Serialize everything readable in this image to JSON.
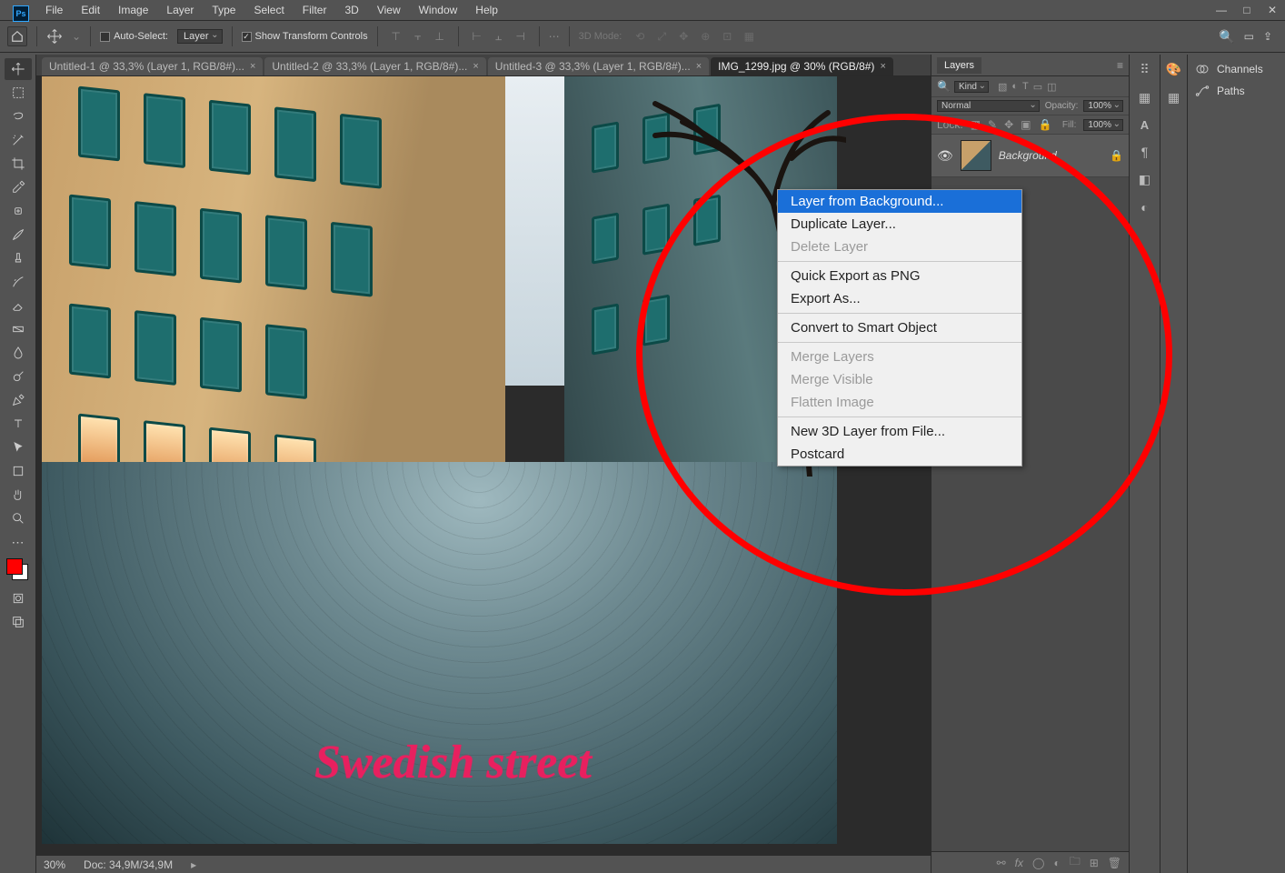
{
  "app": {
    "logo_text": "Ps"
  },
  "menu": [
    "File",
    "Edit",
    "Image",
    "Layer",
    "Type",
    "Select",
    "Filter",
    "3D",
    "View",
    "Window",
    "Help"
  ],
  "options": {
    "auto_select": "Auto-Select:",
    "layer_dd": "Layer",
    "show_transform": "Show Transform Controls",
    "mode_3d": "3D Mode:"
  },
  "tabs": [
    "Untitled-1 @ 33,3% (Layer 1, RGB/8#)...",
    "Untitled-2 @ 33,3% (Layer 1, RGB/8#)...",
    "Untitled-3 @ 33,3% (Layer 1, RGB/8#)...",
    "IMG_1299.jpg @ 30% (RGB/8#)"
  ],
  "active_tab": 3,
  "caption": "Swedish street",
  "status": {
    "zoom": "30%",
    "doc": "Doc: 34,9M/34,9M"
  },
  "layers_panel": {
    "title": "Layers",
    "kind_label": "Kind",
    "blend": "Normal",
    "opacity_label": "Opacity:",
    "opacity_val": "100%",
    "fill_label": "Fill:",
    "fill_val": "100%",
    "lock_label": "Lock:",
    "layer_name": "Background"
  },
  "search_icon": "🔍",
  "right_tabs": {
    "channels": "Channels",
    "paths": "Paths"
  },
  "panel_letters": {
    "a": "A",
    "para": "¶"
  },
  "context": {
    "items": [
      {
        "label": "Layer from Background...",
        "hl": true
      },
      {
        "label": "Duplicate Layer..."
      },
      {
        "label": "Delete Layer",
        "dis": true
      },
      {
        "sep": true
      },
      {
        "label": "Quick Export as PNG"
      },
      {
        "label": "Export As..."
      },
      {
        "sep": true
      },
      {
        "label": "Convert to Smart Object"
      },
      {
        "sep": true
      },
      {
        "label": "Merge Layers",
        "dis": true
      },
      {
        "label": "Merge Visible",
        "dis": true
      },
      {
        "label": "Flatten Image",
        "dis": true
      },
      {
        "sep": true
      },
      {
        "label": "New 3D Layer from File..."
      },
      {
        "label": "Postcard"
      }
    ]
  }
}
